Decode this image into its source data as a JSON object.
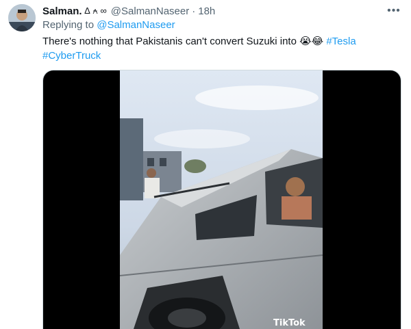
{
  "tweet": {
    "display_name": "Salman.",
    "badges": "∆ ⍲ ∞",
    "handle": "@SalmanNaseer",
    "separator": "·",
    "time": "18h",
    "replying_prefix": "Replying to",
    "replying_to": "@SalmanNaseer",
    "text": "There's nothing that Pakistanis can't convert Suzuki into",
    "emojis": "😭😂",
    "hashtags": [
      "#Tesla",
      "#CyberTruck"
    ]
  },
  "menu": {
    "more_label": "•••"
  },
  "media": {
    "watermark": "TikTok"
  },
  "colors": {
    "link": "#1d9bf0",
    "secondary": "#536471"
  }
}
